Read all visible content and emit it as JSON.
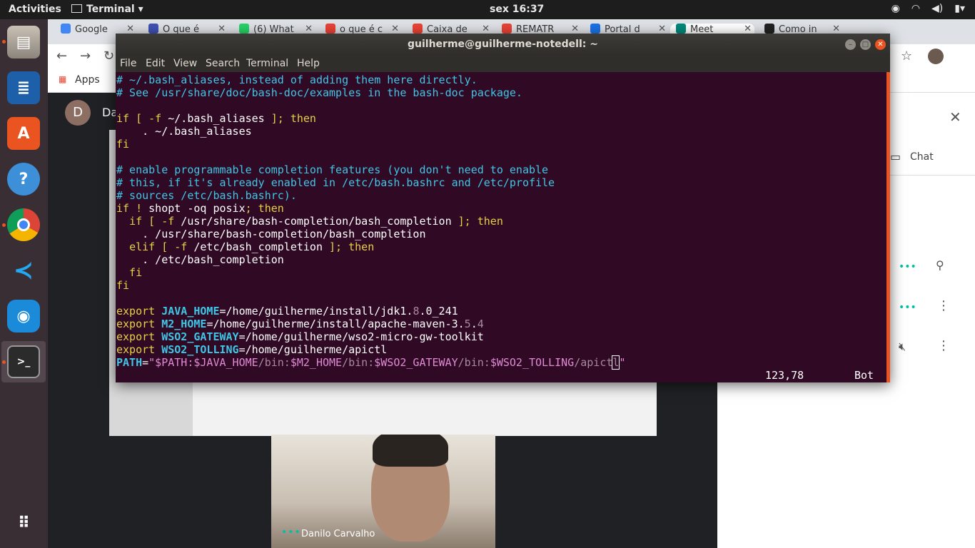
{
  "topbar": {
    "activities": "Activities",
    "app": "Terminal",
    "clock": "sex 16:37"
  },
  "browser": {
    "tabs": [
      {
        "label": "Google ",
        "color": "#4285f4"
      },
      {
        "label": "O que é ",
        "color": "#3f51b5"
      },
      {
        "label": "(6) What",
        "color": "#25d366"
      },
      {
        "label": "o que é c",
        "color": "#ea4335"
      },
      {
        "label": "Caixa de",
        "color": "#ea4335"
      },
      {
        "label": "REMATR",
        "color": "#ea4335"
      },
      {
        "label": "Portal d",
        "color": "#1a73e8"
      },
      {
        "label": "Meet",
        "color": "#00897b"
      },
      {
        "label": "Como in",
        "color": "#222222"
      }
    ],
    "bookmarks_apps": "Apps",
    "meet_avatar": "D",
    "meet_title_partial": "Da",
    "panel_chat": "Chat",
    "webcam_name": "Danilo Carvalho",
    "webcam_dots": "•••"
  },
  "terminal": {
    "title": "guilherme@guilherme-notedell: ~",
    "menu": [
      "File",
      "Edit",
      "View",
      "Search",
      "Terminal",
      "Help"
    ],
    "status_pos": "123,78",
    "status_where": "Bot"
  }
}
